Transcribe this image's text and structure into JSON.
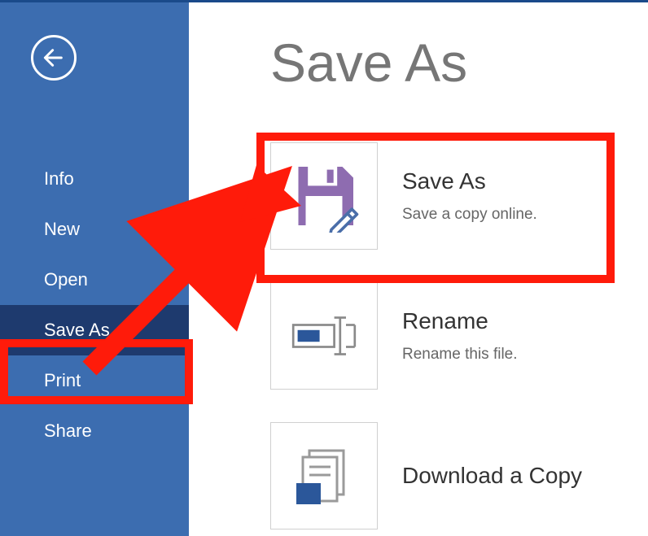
{
  "sidebar": {
    "items": [
      {
        "label": "Info"
      },
      {
        "label": "New"
      },
      {
        "label": "Open"
      },
      {
        "label": "Save As",
        "active": true
      },
      {
        "label": "Print"
      },
      {
        "label": "Share"
      }
    ]
  },
  "main": {
    "title": "Save As",
    "options": [
      {
        "title": "Save As",
        "desc": "Save a copy online."
      },
      {
        "title": "Rename",
        "desc": "Rename this file."
      },
      {
        "title": "Download a Copy",
        "desc": ""
      }
    ]
  }
}
